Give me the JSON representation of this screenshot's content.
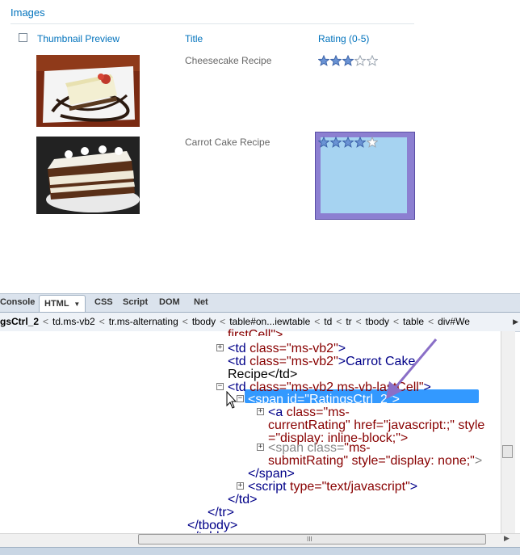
{
  "list": {
    "title": "Images",
    "columns": {
      "thumbnail": "Thumbnail Preview",
      "title": "Title",
      "rating": "Rating (0-5)"
    },
    "rows": [
      {
        "title": "Cheesecake Recipe",
        "rating": 3,
        "max_rating": 5
      },
      {
        "title": "Carrot Cake Recipe",
        "rating": 4,
        "max_rating": 5
      }
    ]
  },
  "firebug": {
    "tabs": [
      "Console",
      "HTML",
      "CSS",
      "Script",
      "DOM",
      "Net"
    ],
    "active_tab": "HTML",
    "tab_menu_arrow": "▼",
    "breadcrumb": [
      "gsCtrl_2",
      "td.ms-vb2",
      "tr.ms-alternating",
      "tbody",
      "table#on...iewtable",
      "td",
      "tr",
      "tbody",
      "table",
      "div#We"
    ],
    "code_lines": {
      "l0": "firstCell\">",
      "l1_tag": "<td",
      "l1_attr": "class=",
      "l1_val": "\"ms-vb2\"",
      "l1_end": ">",
      "l2_tag": "<td",
      "l2_attr": "class=",
      "l2_val": "\"ms-vb2\"",
      "l2_end": ">Carrot Cake",
      "l3": "Recipe</td>",
      "l4_tag": "<td",
      "l4_attr": "class=",
      "l4_val": "\"ms-vb2 ms-vb-lastCell\"",
      "l4_end": ">",
      "l5": "<span id=\"RatingsCtrl_2\">",
      "l6_tag": "<a",
      "l6_attr": "class=",
      "l6_val": "\"ms-",
      "l7_val": "currentRating\"",
      "l7_attr": "href=",
      "l7_val2": "\"javascript:;\"",
      "l7_attr2": "style",
      "l8": "=\"display: inline-block;\">",
      "l9_tag": "<span",
      "l9_attr": "class=",
      "l9_val": "\"ms-",
      "l10_val": "submitRating\"",
      "l10_attr": "style=",
      "l10_val2": "\"display: none;\"",
      "l10_end": ">",
      "l11": "</span>",
      "l12_tag": "<script",
      "l12_attr": "type=",
      "l12_val": "\"text/javascript\"",
      "l12_end": ">",
      "l13": "</td>",
      "l14": "</tr>",
      "l15": "</tbody>",
      "l16": "</tabl"
    },
    "expander_plus": "+",
    "expander_minus": "−",
    "hscroll_grip": "III",
    "hscroll_arrow": "▶",
    "crumb_more": "▶"
  },
  "colors": {
    "link_blue": "#0072bc",
    "selection": "#3399ff",
    "annotation_arrow": "#8a6fc7",
    "highlight_fill": "#a6d3f1"
  }
}
